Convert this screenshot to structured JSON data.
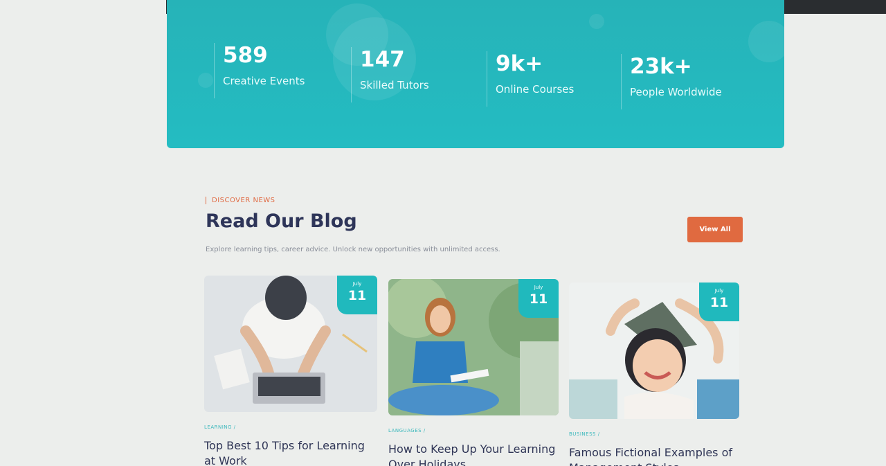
{
  "stats": [
    {
      "number": "589",
      "label": "Creative Events"
    },
    {
      "number": "147",
      "label": "Skilled Tutors"
    },
    {
      "number": "9k+",
      "label": "Online Courses"
    },
    {
      "number": "23k+",
      "label": "People Worldwide"
    }
  ],
  "blog": {
    "eyebrow": "DISCOVER NEWS",
    "title": "Read Our Blog",
    "subtitle": "Explore learning tips, career advice. Unlock new opportunities with unlimited access.",
    "view_all_label": "View All",
    "posts": [
      {
        "month": "July",
        "day": "11",
        "category": "LEARNING /",
        "title": "Top Best 10 Tips for Learning at Work"
      },
      {
        "month": "July",
        "day": "11",
        "category": "LANGUAGES /",
        "title": "How to Keep Up Your Learning Over Holidays"
      },
      {
        "month": "July",
        "day": "11",
        "category": "BUSINESS /",
        "title": "Famous Fictional Examples of Management Styles"
      }
    ]
  },
  "colors": {
    "accent_teal": "#24bcc2",
    "accent_orange": "#e06a40",
    "heading": "#2e3559"
  }
}
